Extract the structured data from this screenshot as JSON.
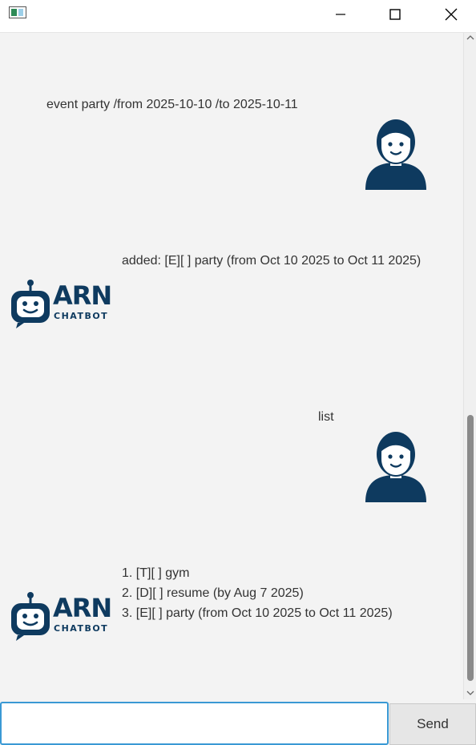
{
  "window": {
    "app_icon": "app-window-icon",
    "controls": [
      "minimize-icon",
      "maximize-icon",
      "close-icon"
    ]
  },
  "messages": [
    {
      "sender": "user",
      "text": "event party /from 2025-10-10 /to 2025-10-11"
    },
    {
      "sender": "bot",
      "text": "added: [E][ ] party (from Oct 10 2025 to Oct 11 2025)"
    },
    {
      "sender": "user",
      "text": "list"
    },
    {
      "sender": "bot",
      "lines": [
        "1. [T][ ] gym",
        "2. [D][ ] resume (by Aug 7 2025)",
        "3. [E][ ] party (from Oct 10 2025 to Oct 11 2025)"
      ]
    }
  ],
  "bot_logo": {
    "name": "ARN",
    "subtitle": "CHATBOT"
  },
  "input": {
    "value": "",
    "placeholder": ""
  },
  "send_label": "Send",
  "colors": {
    "accent": "#0e3a5f",
    "input_border": "#3a99d4"
  }
}
